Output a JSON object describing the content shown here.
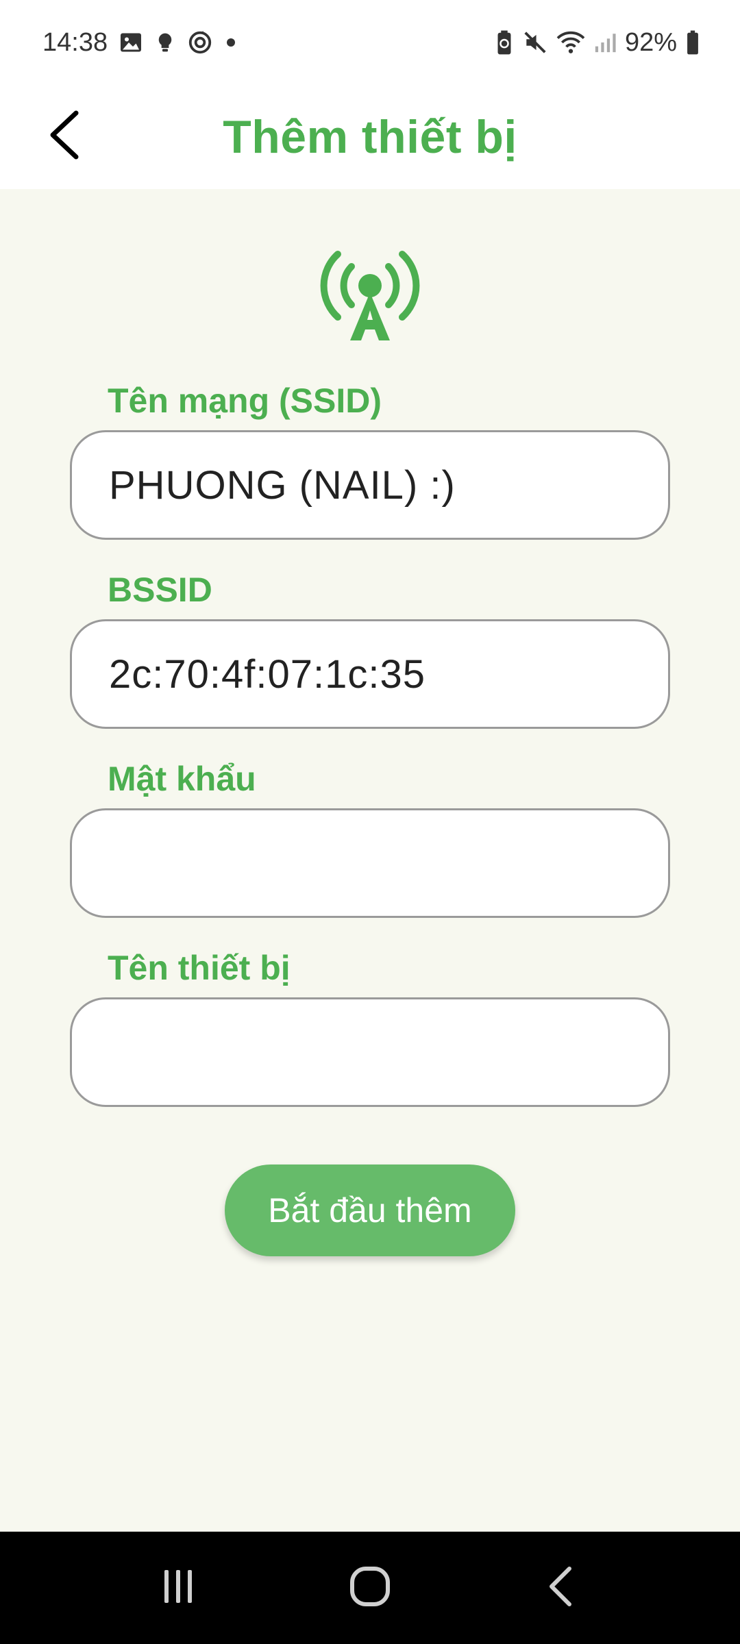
{
  "status_bar": {
    "time": "14:38",
    "battery_percent": "92%",
    "left_icons": [
      "image-icon",
      "bulb-icon",
      "sync-icon",
      "dot-icon"
    ],
    "right_icons": [
      "battery-saver-icon",
      "mute-icon",
      "wifi-icon",
      "signal-icon",
      "battery-icon"
    ]
  },
  "header": {
    "title": "Thêm thiết bị",
    "back_icon": "chevron-left-icon"
  },
  "form": {
    "icon": "antenna-icon",
    "ssid": {
      "label": "Tên mạng (SSID)",
      "value": "PHUONG (NAIL) :)"
    },
    "bssid": {
      "label": "BSSID",
      "value": "2c:70:4f:07:1c:35"
    },
    "password": {
      "label": "Mật khẩu",
      "value": ""
    },
    "device_name": {
      "label": "Tên thiết bị",
      "value": ""
    },
    "submit_label": "Bắt đầu thêm"
  },
  "nav_bar": {
    "recents_icon": "recents-icon",
    "home_icon": "home-icon",
    "back_icon": "back-icon"
  },
  "colors": {
    "accent": "#4caf50",
    "button": "#66bb6a",
    "background": "#f7f8ef"
  }
}
